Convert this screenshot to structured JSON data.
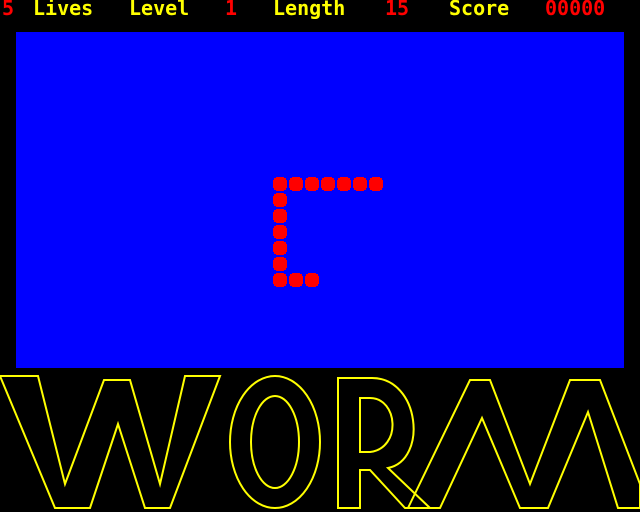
{
  "hud": {
    "lives_value": "5",
    "lives_label": "Lives",
    "level_label": "Level",
    "level_value": "1",
    "length_label": "Length",
    "length_value": "15",
    "score_label": "Score",
    "score_value": "00000"
  },
  "colors": {
    "background": "#000000",
    "playfield": "#0000ff",
    "hud_label": "#ffff00",
    "hud_value": "#ff0000",
    "worm": "#ff0000",
    "logo_outline": "#ffff00"
  },
  "worm": {
    "segment_count": 15
  },
  "logo": {
    "text": "WORM"
  }
}
